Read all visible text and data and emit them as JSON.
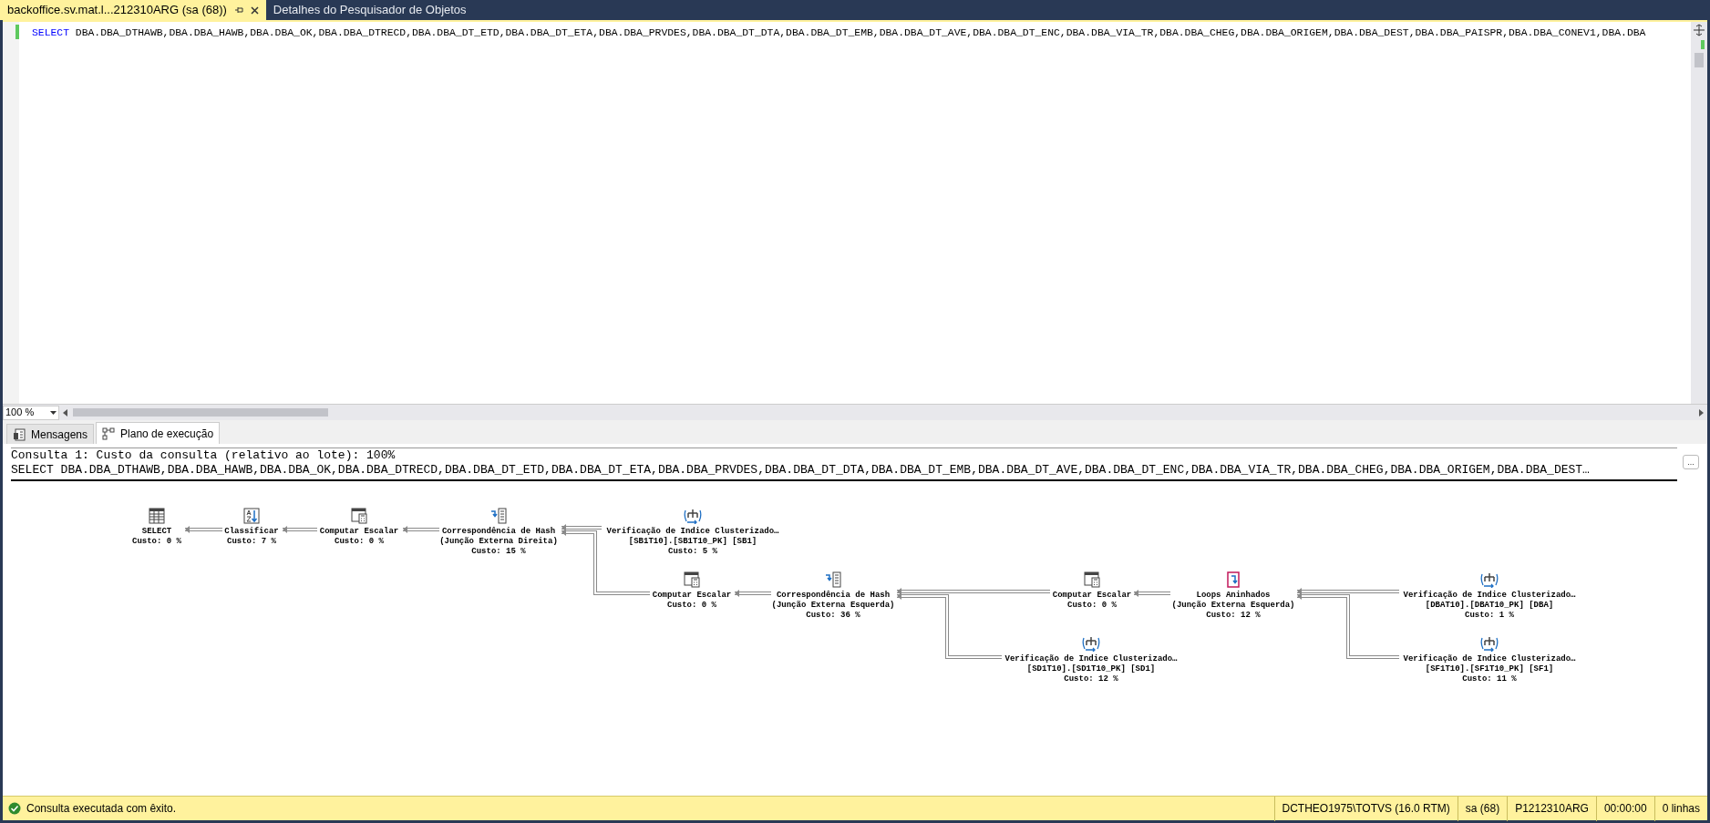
{
  "document_tabs": [
    {
      "label": "backoffice.sv.mat.l...212310ARG (sa (68))",
      "selected": true
    },
    {
      "label": "Detalhes do Pesquisador de Objetos",
      "selected": false
    }
  ],
  "editor": {
    "keyword": "SELECT",
    "text": "DBA.DBA_DTHAWB,DBA.DBA_HAWB,DBA.DBA_OK,DBA.DBA_DTRECD,DBA.DBA_DT_ETD,DBA.DBA_DT_ETA,DBA.DBA_PRVDES,DBA.DBA_DT_DTA,DBA.DBA_DT_EMB,DBA.DBA_DT_AVE,DBA.DBA_DT_ENC,DBA.DBA_VIA_TR,DBA.DBA_CHEG,DBA.DBA_ORIGEM,DBA.DBA_DEST,DBA.DBA_PAISPR,DBA.DBA_CONEV1,DBA.DBA"
  },
  "zoom": "100 %",
  "result_tabs": [
    {
      "label": "Mensagens",
      "kind": "messages",
      "selected": false
    },
    {
      "label": "Plano de execução",
      "kind": "plan",
      "selected": true
    }
  ],
  "plan_header": {
    "line_1": "Consulta 1: Custo da consulta (relativo ao lote): 100%",
    "line_2": "SELECT DBA.DBA_DTHAWB,DBA.DBA_HAWB,DBA.DBA_OK,DBA.DBA_DTRECD,DBA.DBA_DT_ETD,DBA.DBA_DT_ETA,DBA.DBA_PRVDES,DBA.DBA_DT_DTA,DBA.DBA_DT_EMB,DBA.DBA_DT_AVE,DBA.DBA_DT_ENC,DBA.DBA_VIA_TR,DBA.DBA_CHEG,DBA.DBA_ORIGEM,DBA.DBA_DEST…",
    "more_button": "..."
  },
  "plan_nodes": [
    {
      "kind": "select",
      "lines": [
        "SELECT"
      ],
      "cost": "Custo: 0 %"
    },
    {
      "kind": "sort",
      "lines": [
        "Classificar"
      ],
      "cost": "Custo: 7 %"
    },
    {
      "kind": "compute",
      "lines": [
        "Computar Escalar"
      ],
      "cost": "Custo: 0 %"
    },
    {
      "kind": "hash",
      "lines": [
        "Correspondência de Hash",
        "(Junção Externa Direita)"
      ],
      "cost": "Custo: 15 %"
    },
    {
      "kind": "scan",
      "lines": [
        "Verificação de Indice Clusterizado…",
        "[SB1T10].[SB1T10_PK] [SB1]"
      ],
      "cost": "Custo: 5 %"
    },
    {
      "kind": "compute",
      "lines": [
        "Computar Escalar"
      ],
      "cost": "Custo: 0 %"
    },
    {
      "kind": "hash",
      "lines": [
        "Correspondência de Hash",
        "(Junção Externa Esquerda)"
      ],
      "cost": "Custo: 36 %"
    },
    {
      "kind": "compute",
      "lines": [
        "Computar Escalar"
      ],
      "cost": "Custo: 0 %"
    },
    {
      "kind": "loops",
      "lines": [
        "Loops Aninhados",
        "(Junção Externa Esquerda)"
      ],
      "cost": "Custo: 12 %"
    },
    {
      "kind": "scan",
      "lines": [
        "Verificação de Indice Clusterizado…",
        "[DBAT10].[DBAT10_PK] [DBA]"
      ],
      "cost": "Custo: 1 %"
    },
    {
      "kind": "scan",
      "lines": [
        "Verificação de Indice Clusterizado…",
        "[SD1T10].[SD1T10_PK] [SD1]"
      ],
      "cost": "Custo: 12 %"
    },
    {
      "kind": "scan",
      "lines": [
        "Verificação de Indice Clusterizado…",
        "[SF1T10].[SF1T10_PK] [SF1]"
      ],
      "cost": "Custo: 11 %"
    }
  ],
  "status": {
    "message": "Consulta executada com êxito.",
    "fields": [
      "DCTHEO1975\\TOTVS (16.0 RTM)",
      "sa (68)",
      "P1212310ARG",
      "00:00:00",
      "0 linhas"
    ]
  }
}
